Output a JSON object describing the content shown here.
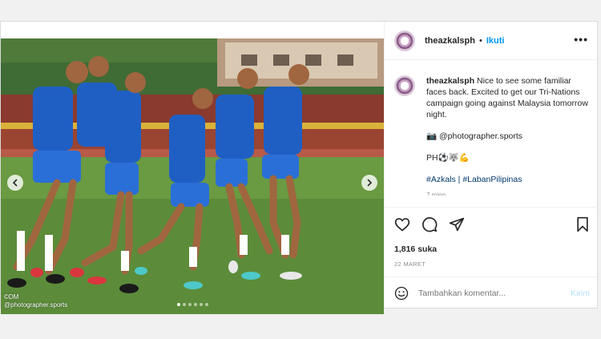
{
  "header": {
    "username": "theazkalsph",
    "separator": "•",
    "follow_label": "Ikuti",
    "more_label": "•••"
  },
  "caption": {
    "username": "theazkalsph",
    "text": "Nice to see some familiar faces back. Excited to get our Tri-Nations campaign going against Malaysia tomorrow night.",
    "photographer": "📷 @photographer.sports",
    "emoji_line": "PH⚽🐺💪",
    "hashtags": "#Azkals | #LabanPilipinas",
    "time_partial": "7 ming"
  },
  "photo": {
    "credit_line1": "©DM",
    "credit_line2": "@photographer.sports",
    "dot_count": 6,
    "active_dot": 0
  },
  "actions": {
    "likes": "1,816 suka",
    "date": "22 MARET"
  },
  "comment": {
    "placeholder": "Tambahkan komentar...",
    "post_label": "Kirim"
  },
  "icons": {
    "like": "heart-icon",
    "comment": "comment-icon",
    "share": "share-icon",
    "save": "bookmark-icon",
    "emoji": "emoji-icon",
    "prev": "chevron-left-icon",
    "next": "chevron-right-icon"
  }
}
